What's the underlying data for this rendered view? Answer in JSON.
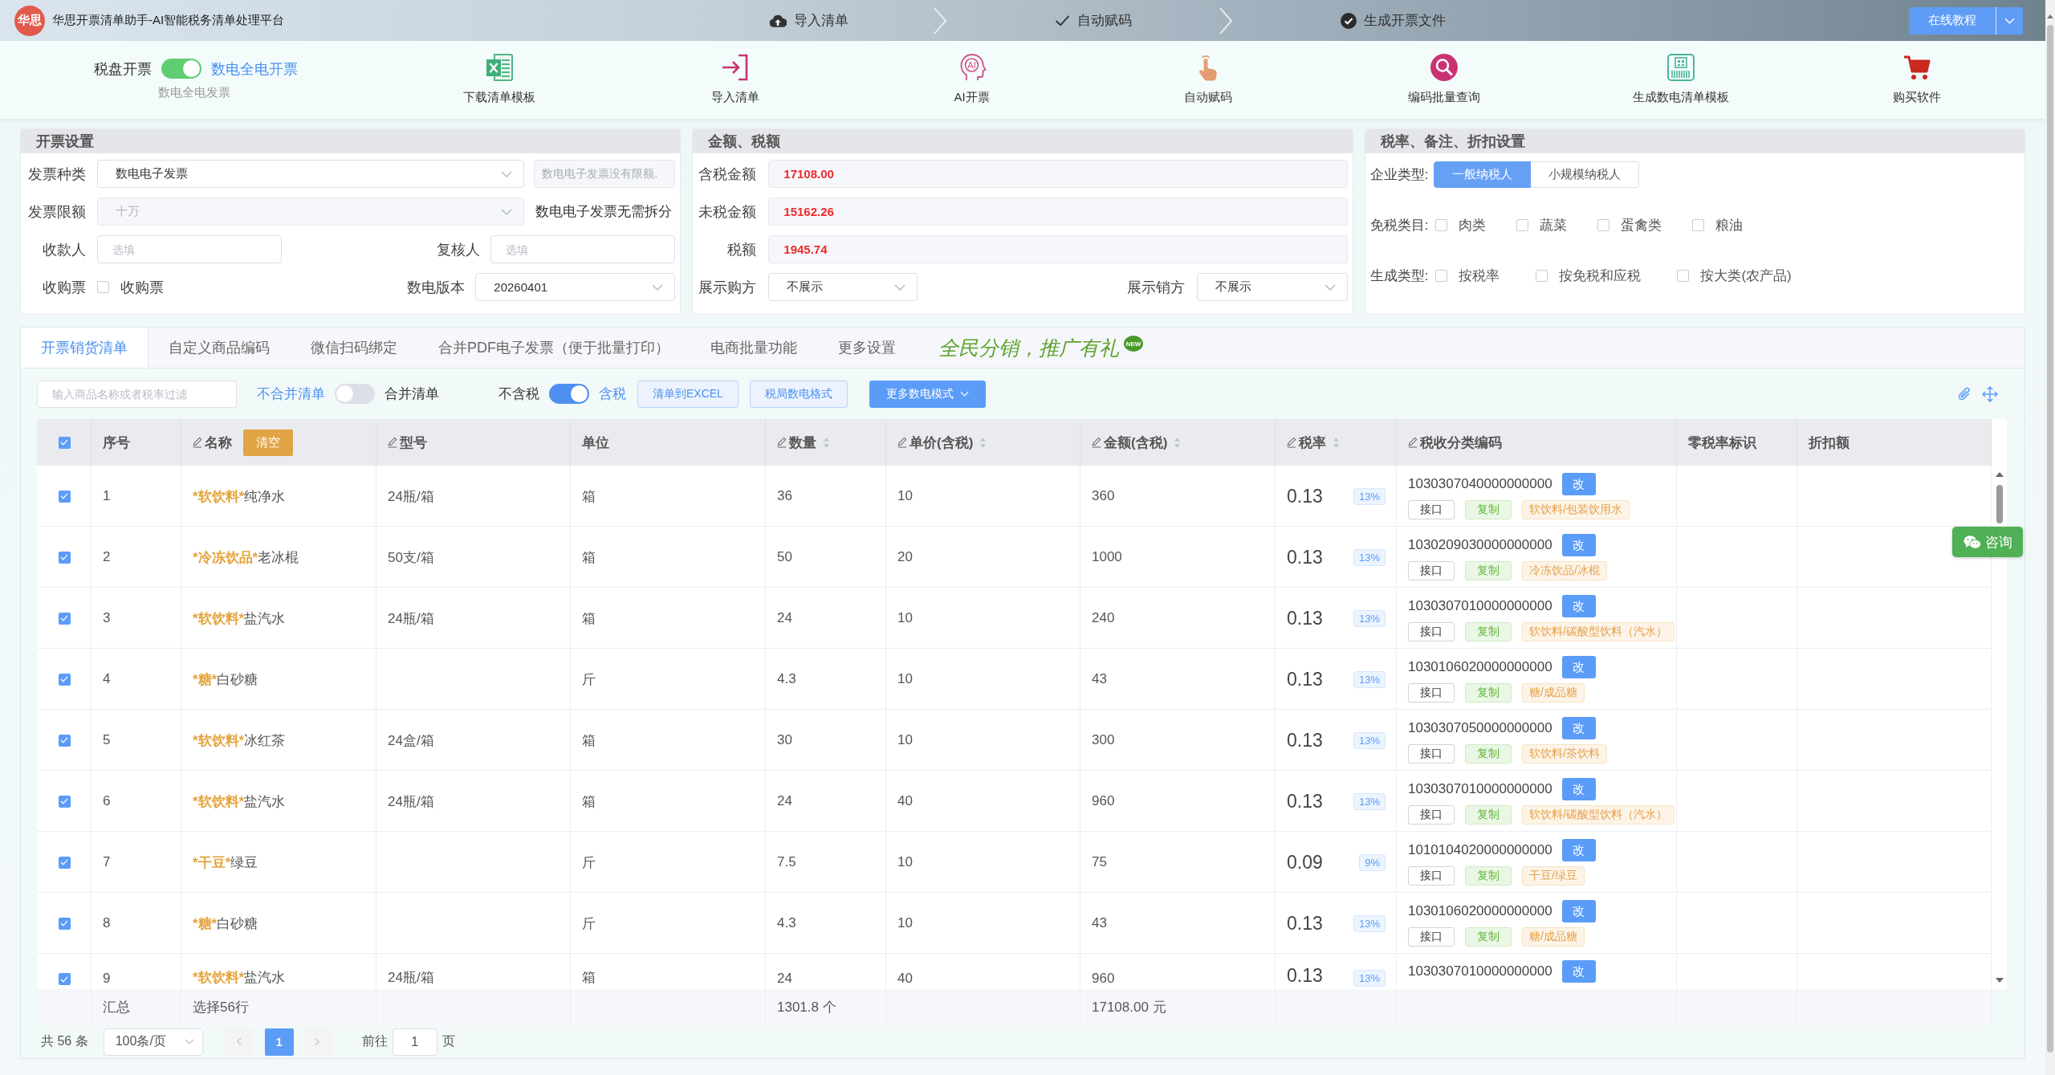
{
  "header": {
    "logo_text": "华思",
    "title": "华思开票清单助手-AI智能税务清单处理平台",
    "steps": [
      "导入清单",
      "自动赋码",
      "生成开票文件"
    ],
    "tutorial_button": "在线教程"
  },
  "toolbar": {
    "mode_switch": {
      "off_label": "税盘开票",
      "on_label": "数电全电开票",
      "on": true,
      "caption": "数电全电发票"
    },
    "tools": [
      {
        "label": "下载清单模板"
      },
      {
        "label": "导入清单"
      },
      {
        "label": "AI开票",
        "icon_text": "AI"
      },
      {
        "label": "自动赋码"
      },
      {
        "label": "编码批量查询"
      },
      {
        "label": "生成数电清单模板"
      },
      {
        "label": "购买软件"
      }
    ]
  },
  "invoice_settings": {
    "title": "开票设置",
    "invoice_type": {
      "label": "发票种类",
      "value": "数电电子发票",
      "disabled": false
    },
    "invoice_type_note": "数电电子发票没有限额.",
    "limit": {
      "label": "发票限额",
      "value": "十万",
      "disabled": true
    },
    "limit_note": "数电电子发票无需拆分",
    "payee": {
      "label": "收款人",
      "placeholder": "选填"
    },
    "reviewer": {
      "label": "复核人",
      "placeholder": "选填"
    },
    "purchase": {
      "label": "收购票",
      "option": "收购票",
      "checked": false
    },
    "version": {
      "label": "数电版本",
      "value": "20260401"
    }
  },
  "amounts": {
    "title": "金额、税额",
    "fields": [
      {
        "label": "含税金额",
        "value": "17108.00"
      },
      {
        "label": "未税金额",
        "value": "15162.26"
      },
      {
        "label": "税额",
        "value": "1945.74"
      }
    ],
    "buyer_display": {
      "label": "展示购方",
      "value": "不展示"
    },
    "seller_display": {
      "label": "展示销方",
      "value": "不展示"
    }
  },
  "rate_settings": {
    "title": "税率、备注、折扣设置",
    "company_type": {
      "label": "企业类型:",
      "options": [
        {
          "label": "一般纳税人",
          "selected": true
        },
        {
          "label": "小规模纳税人",
          "selected": false
        }
      ]
    },
    "exempt_categories": {
      "label": "免税类目:",
      "options": [
        {
          "label": "肉类",
          "checked": false
        },
        {
          "label": "蔬菜",
          "checked": false
        },
        {
          "label": "蛋禽类",
          "checked": false
        },
        {
          "label": "粮油",
          "checked": false
        }
      ]
    },
    "generate_type": {
      "label": "生成类型:",
      "options": [
        {
          "label": "按税率",
          "checked": false
        },
        {
          "label": "按免税和应税",
          "checked": false
        },
        {
          "label": "按大类(农产品)",
          "checked": false
        }
      ]
    }
  },
  "tabs": [
    {
      "label": "开票销货清单",
      "selected": true
    },
    {
      "label": "自定义商品编码",
      "selected": false
    },
    {
      "label": "微信扫码绑定",
      "selected": false
    },
    {
      "label": "合并PDF电子发票（便于批量打印）",
      "selected": false
    },
    {
      "label": "电商批量功能",
      "selected": false
    },
    {
      "label": "更多设置",
      "selected": false
    }
  ],
  "promo": {
    "text": "全民分销，推广有礼",
    "badge": "NEW"
  },
  "list_toolbar": {
    "search": {
      "placeholder": "输入商品名称或者税率过滤"
    },
    "merge_switch": {
      "off_label": "不合并清单",
      "on_label": "合并清单",
      "on": false
    },
    "tax_switch": {
      "off_label": "不含税",
      "on_label": "含税",
      "on": true
    },
    "buttons": [
      {
        "label": "清单到EXCEL",
        "kind": "plain"
      },
      {
        "label": "税局数电格式",
        "kind": "plain"
      },
      {
        "label": "更多数电模式",
        "kind": "dropdown"
      }
    ]
  },
  "table": {
    "all_checked": true,
    "columns": [
      {
        "label": "序号",
        "editable": false,
        "sortable": false
      },
      {
        "label": "名称",
        "editable": true,
        "sortable": false,
        "action": "清空"
      },
      {
        "label": "型号",
        "editable": true,
        "sortable": false
      },
      {
        "label": "单位",
        "editable": false,
        "sortable": false
      },
      {
        "label": "数量",
        "editable": true,
        "sortable": true
      },
      {
        "label": "单价(含税)",
        "editable": true,
        "sortable": true
      },
      {
        "label": "金额(含税)",
        "editable": true,
        "sortable": true
      },
      {
        "label": "税率",
        "editable": true,
        "sortable": true
      },
      {
        "label": "税收分类编码",
        "editable": true,
        "sortable": false
      },
      {
        "label": "零税率标识",
        "editable": false,
        "sortable": false
      },
      {
        "label": "折扣额",
        "editable": false,
        "sortable": false
      }
    ],
    "rows": [
      {
        "checked": true,
        "no": "1",
        "name": "*软饮料*纯净水",
        "model": "24瓶/箱",
        "unit": "箱",
        "quantity": "36",
        "price": "10",
        "amount": "360",
        "rate": "0.13",
        "rate_tag": "13%",
        "tax_code": "1030307040000000000",
        "edit_label": "改",
        "interface_label": "接口",
        "copy_label": "复制",
        "category": "软饮料/包装饮用水"
      },
      {
        "checked": true,
        "no": "2",
        "name": "*冷冻饮品*老冰棍",
        "model": "50支/箱",
        "unit": "箱",
        "quantity": "50",
        "price": "20",
        "amount": "1000",
        "rate": "0.13",
        "rate_tag": "13%",
        "tax_code": "1030209030000000000",
        "edit_label": "改",
        "interface_label": "接口",
        "copy_label": "复制",
        "category": "冷冻饮品/冰棍"
      },
      {
        "checked": true,
        "no": "3",
        "name": "*软饮料*盐汽水",
        "model": "24瓶/箱",
        "unit": "箱",
        "quantity": "24",
        "price": "10",
        "amount": "240",
        "rate": "0.13",
        "rate_tag": "13%",
        "tax_code": "1030307010000000000",
        "edit_label": "改",
        "interface_label": "接口",
        "copy_label": "复制",
        "category": "软饮料/碳酸型饮料（汽水）"
      },
      {
        "checked": true,
        "no": "4",
        "name": "*糖*白砂糖",
        "unit": "斤",
        "quantity": "4.3",
        "price": "10",
        "amount": "43",
        "rate": "0.13",
        "rate_tag": "13%",
        "tax_code": "1030106020000000000",
        "edit_label": "改",
        "interface_label": "接口",
        "copy_label": "复制",
        "category": "糖/成品糖"
      },
      {
        "checked": true,
        "no": "5",
        "name": "*软饮料*冰红茶",
        "model": "24盒/箱",
        "unit": "箱",
        "quantity": "30",
        "price": "10",
        "amount": "300",
        "rate": "0.13",
        "rate_tag": "13%",
        "tax_code": "1030307050000000000",
        "edit_label": "改",
        "interface_label": "接口",
        "copy_label": "复制",
        "category": "软饮料/茶饮料"
      },
      {
        "checked": true,
        "no": "6",
        "name": "*软饮料*盐汽水",
        "model": "24瓶/箱",
        "unit": "箱",
        "quantity": "24",
        "price": "40",
        "amount": "960",
        "rate": "0.13",
        "rate_tag": "13%",
        "tax_code": "1030307010000000000",
        "edit_label": "改",
        "interface_label": "接口",
        "copy_label": "复制",
        "category": "软饮料/碳酸型饮料（汽水）"
      },
      {
        "checked": true,
        "no": "7",
        "name": "*干豆*绿豆",
        "unit": "斤",
        "quantity": "7.5",
        "price": "10",
        "amount": "75",
        "rate": "0.09",
        "rate_tag": "9%",
        "tax_code": "1010104020000000000",
        "edit_label": "改",
        "interface_label": "接口",
        "copy_label": "复制",
        "category": "干豆/绿豆"
      },
      {
        "checked": true,
        "no": "8",
        "name": "*糖*白砂糖",
        "unit": "斤",
        "quantity": "4.3",
        "price": "10",
        "amount": "43",
        "rate": "0.13",
        "rate_tag": "13%",
        "tax_code": "1030106020000000000",
        "edit_label": "改",
        "interface_label": "接口",
        "copy_label": "复制",
        "category": "糖/成品糖"
      },
      {
        "checked": true,
        "no": "9",
        "name": "*软饮料*盐汽水",
        "model": "24瓶/箱",
        "unit": "箱",
        "quantity": "24",
        "price": "40",
        "amount": "960",
        "rate": "0.13",
        "rate_tag": "13%",
        "tax_code": "1030307010000000000",
        "edit_label": "改"
      }
    ],
    "summary": {
      "label": "汇总",
      "selection": "选择56行",
      "quantity": "1301.8 个",
      "amount": "17108.00 元"
    }
  },
  "pagination": {
    "total": "共 56 条",
    "page_size": "100条/页",
    "pages": [
      {
        "label": "1",
        "selected": true
      }
    ],
    "goto_label": "前往",
    "goto_value": "1",
    "page_suffix": "页"
  },
  "consult_button": "咨询"
}
